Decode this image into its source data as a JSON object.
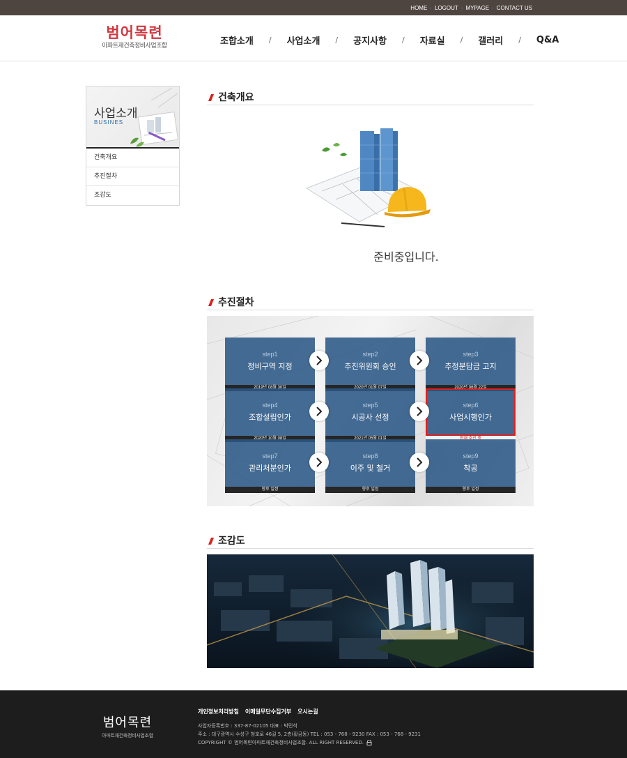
{
  "topbar": {
    "links": [
      "HOME",
      "LOGOUT",
      "MYPAGE",
      "CONTACT US"
    ]
  },
  "header": {
    "logo_name": "범어목련",
    "logo_sub": "아파트재건축정비사업조합",
    "nav": [
      "조합소개",
      "사업소개",
      "공지사항",
      "자료실",
      "갤러리",
      "Q&A"
    ]
  },
  "sidebar": {
    "title": "사업소개",
    "title_en": "BUSINES",
    "items": [
      "건축개요",
      "추진절차",
      "조감도"
    ]
  },
  "sections": {
    "overview": "건축개요",
    "process": "추진절차",
    "birdview": "조감도"
  },
  "ready_text": "준비중입니다.",
  "steps": [
    {
      "num": "step1",
      "title": "정비구역 지정",
      "date": "2019년 08월 30일"
    },
    {
      "num": "step2",
      "title": "추진위원회 승인",
      "date": "2020년 01월 07일"
    },
    {
      "num": "step3",
      "title": "추정분담금 고지",
      "date": "2020년 06월 22일"
    },
    {
      "num": "step4",
      "title": "조합설립인가",
      "date": "2020년 10월 08일"
    },
    {
      "num": "step5",
      "title": "시공사 선정",
      "date": "2021년 05월 01일"
    },
    {
      "num": "step6",
      "title": "사업시행인가",
      "date": "현재 추진 중"
    },
    {
      "num": "step7",
      "title": "관리처분인가",
      "date": "향후 일정"
    },
    {
      "num": "step8",
      "title": "이주 및 철거",
      "date": "향후 일정"
    },
    {
      "num": "step9",
      "title": "착공",
      "date": "향후 일정"
    }
  ],
  "footer": {
    "logo_name": "범어목련",
    "logo_sub": "아파트재건축정비사업조합",
    "links": [
      "개인정보처리방침",
      "이메일무단수집거부",
      "오시는길"
    ],
    "info1": "사업자등록번호 : 337-87-02105    대표 : 박민석",
    "info2": "주소 : 대구광역시 수성구 청호로 46길 5, 2층(황금동)    TEL : 053 - 768 - 9230    FAX : 053 - 768 - 9231",
    "copyright": "COPYRIGHT © 범어목련아파트재건축정비사업조합. ALL RIGHT RESERVED."
  },
  "colors": {
    "topbar": "#4f4540",
    "logo": "#d1363e",
    "step_box": "#2b5885",
    "current_border": "#d9221f",
    "footer": "#1d1d1d"
  }
}
